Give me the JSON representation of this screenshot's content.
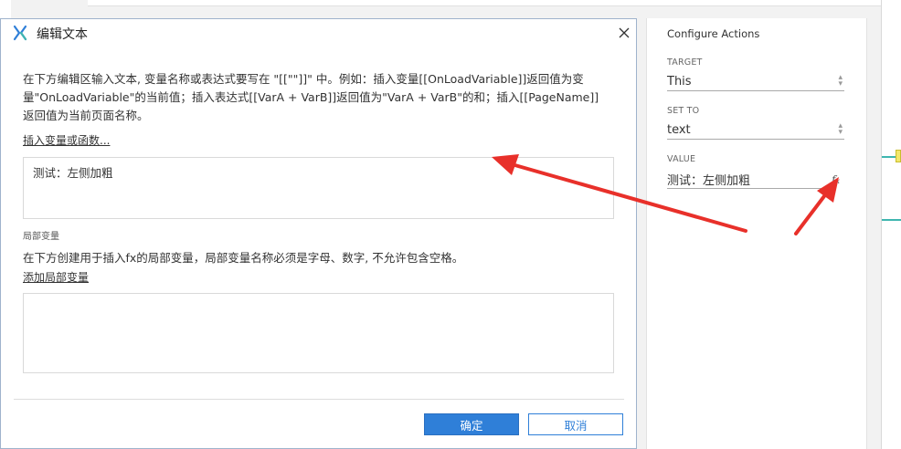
{
  "dialog": {
    "title": "编辑文本",
    "description": "在下方编辑区输入文本, 变量名称或表达式要写在 \"[[\"\"]]\" 中。例如：插入变量[[OnLoadVariable]]返回值为变量\"OnLoadVariable\"的当前值；插入表达式[[VarA + VarB]]返回值为\"VarA + VarB\"的和；插入[[PageName]] 返回值为当前页面名称。",
    "insert_link": "插入变量或函数...",
    "editor_value": "测试：左侧加粗",
    "local_vars_label": "局部变量",
    "local_vars_description": "在下方创建用于插入fx的局部变量，局部变量名称必须是字母、数字, 不允许包含空格。",
    "add_local_var_link": "添加局部变量",
    "local_vars_value": "",
    "ok_label": "确定",
    "cancel_label": "取消"
  },
  "panel": {
    "title": "Configure Actions",
    "target_label": "TARGET",
    "target_value": "This",
    "set_to_label": "SET TO",
    "set_to_value": "text",
    "value_label": "VALUE",
    "value_value": "测试：左侧加粗",
    "fx_icon": "fx-icon"
  },
  "colors": {
    "primary": "#2f7fd8",
    "arrow": "#e8302a",
    "accent_teal": "#3fb6b0"
  }
}
